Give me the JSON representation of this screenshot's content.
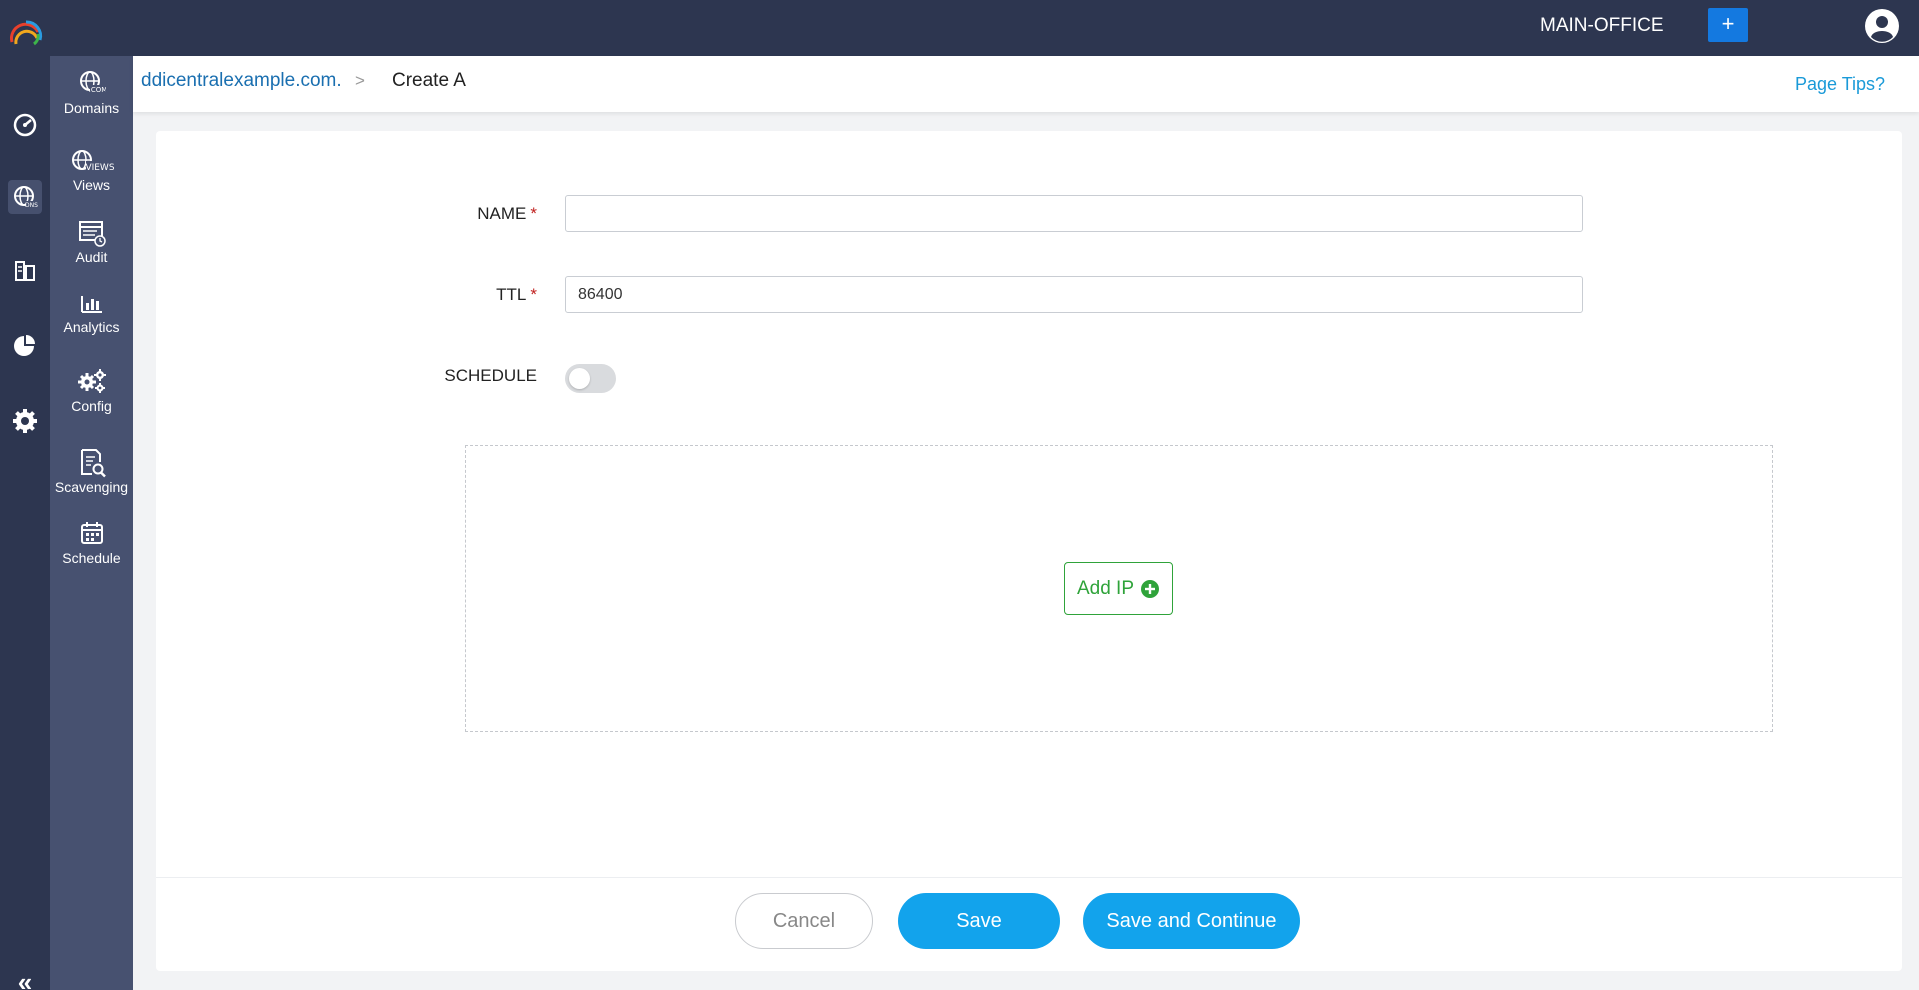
{
  "header": {
    "office": "MAIN-OFFICE",
    "add_button": "+"
  },
  "rail": {
    "collapse_glyph": "«",
    "icons": [
      "dashboard-icon",
      "dns-globe-icon",
      "ipam-icon",
      "reports-icon",
      "settings-icon"
    ]
  },
  "subnav": {
    "items": [
      {
        "label": "Domains",
        "icon": "domains-icon"
      },
      {
        "label": "Views",
        "icon": "views-icon"
      },
      {
        "label": "Audit",
        "icon": "audit-icon"
      },
      {
        "label": "Analytics",
        "icon": "analytics-icon"
      },
      {
        "label": "Config",
        "icon": "config-icon"
      },
      {
        "label": "Scavenging",
        "icon": "scavenging-icon"
      },
      {
        "label": "Schedule",
        "icon": "schedule-icon"
      }
    ]
  },
  "breadcrumb": {
    "link": "ddicentralexample.com.",
    "separator": ">",
    "current": "Create A",
    "page_tips": "Page Tips?"
  },
  "form": {
    "name_label": "NAME",
    "name_value": "",
    "ttl_label": "TTL",
    "ttl_value": "86400",
    "required_mark": "*",
    "schedule_label": "SCHEDULE",
    "schedule_on": false,
    "add_ip_label": "Add IP"
  },
  "footer": {
    "cancel": "Cancel",
    "save": "Save",
    "save_continue": "Save and Continue"
  },
  "colors": {
    "topbar": "#2d3650",
    "subnav": "#475170",
    "primary_button": "#12a3ec",
    "add_ip_green": "#2fa33a",
    "link_blue": "#1a6fb0"
  }
}
